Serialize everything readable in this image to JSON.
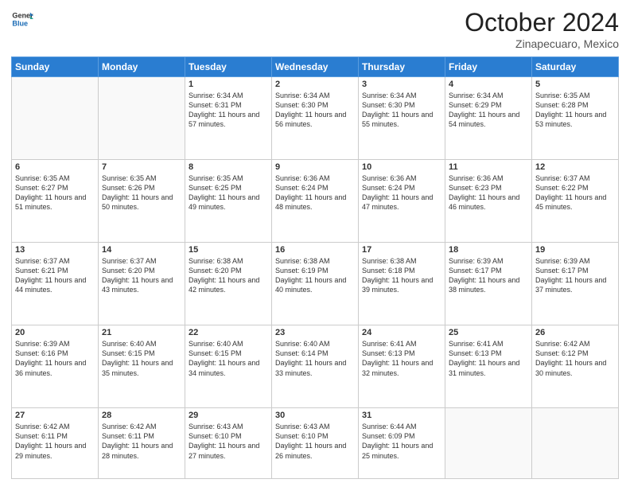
{
  "header": {
    "logo": {
      "line1": "General",
      "line2": "Blue"
    },
    "title": "October 2024",
    "location": "Zinapecuaro, Mexico"
  },
  "weekdays": [
    "Sunday",
    "Monday",
    "Tuesday",
    "Wednesday",
    "Thursday",
    "Friday",
    "Saturday"
  ],
  "weeks": [
    [
      {
        "day": "",
        "empty": true
      },
      {
        "day": "",
        "empty": true
      },
      {
        "day": "1",
        "sunrise": "6:34 AM",
        "sunset": "6:31 PM",
        "daylight": "11 hours and 57 minutes."
      },
      {
        "day": "2",
        "sunrise": "6:34 AM",
        "sunset": "6:30 PM",
        "daylight": "11 hours and 56 minutes."
      },
      {
        "day": "3",
        "sunrise": "6:34 AM",
        "sunset": "6:30 PM",
        "daylight": "11 hours and 55 minutes."
      },
      {
        "day": "4",
        "sunrise": "6:34 AM",
        "sunset": "6:29 PM",
        "daylight": "11 hours and 54 minutes."
      },
      {
        "day": "5",
        "sunrise": "6:35 AM",
        "sunset": "6:28 PM",
        "daylight": "11 hours and 53 minutes."
      }
    ],
    [
      {
        "day": "6",
        "sunrise": "6:35 AM",
        "sunset": "6:27 PM",
        "daylight": "11 hours and 51 minutes."
      },
      {
        "day": "7",
        "sunrise": "6:35 AM",
        "sunset": "6:26 PM",
        "daylight": "11 hours and 50 minutes."
      },
      {
        "day": "8",
        "sunrise": "6:35 AM",
        "sunset": "6:25 PM",
        "daylight": "11 hours and 49 minutes."
      },
      {
        "day": "9",
        "sunrise": "6:36 AM",
        "sunset": "6:24 PM",
        "daylight": "11 hours and 48 minutes."
      },
      {
        "day": "10",
        "sunrise": "6:36 AM",
        "sunset": "6:24 PM",
        "daylight": "11 hours and 47 minutes."
      },
      {
        "day": "11",
        "sunrise": "6:36 AM",
        "sunset": "6:23 PM",
        "daylight": "11 hours and 46 minutes."
      },
      {
        "day": "12",
        "sunrise": "6:37 AM",
        "sunset": "6:22 PM",
        "daylight": "11 hours and 45 minutes."
      }
    ],
    [
      {
        "day": "13",
        "sunrise": "6:37 AM",
        "sunset": "6:21 PM",
        "daylight": "11 hours and 44 minutes."
      },
      {
        "day": "14",
        "sunrise": "6:37 AM",
        "sunset": "6:20 PM",
        "daylight": "11 hours and 43 minutes."
      },
      {
        "day": "15",
        "sunrise": "6:38 AM",
        "sunset": "6:20 PM",
        "daylight": "11 hours and 42 minutes."
      },
      {
        "day": "16",
        "sunrise": "6:38 AM",
        "sunset": "6:19 PM",
        "daylight": "11 hours and 40 minutes."
      },
      {
        "day": "17",
        "sunrise": "6:38 AM",
        "sunset": "6:18 PM",
        "daylight": "11 hours and 39 minutes."
      },
      {
        "day": "18",
        "sunrise": "6:39 AM",
        "sunset": "6:17 PM",
        "daylight": "11 hours and 38 minutes."
      },
      {
        "day": "19",
        "sunrise": "6:39 AM",
        "sunset": "6:17 PM",
        "daylight": "11 hours and 37 minutes."
      }
    ],
    [
      {
        "day": "20",
        "sunrise": "6:39 AM",
        "sunset": "6:16 PM",
        "daylight": "11 hours and 36 minutes."
      },
      {
        "day": "21",
        "sunrise": "6:40 AM",
        "sunset": "6:15 PM",
        "daylight": "11 hours and 35 minutes."
      },
      {
        "day": "22",
        "sunrise": "6:40 AM",
        "sunset": "6:15 PM",
        "daylight": "11 hours and 34 minutes."
      },
      {
        "day": "23",
        "sunrise": "6:40 AM",
        "sunset": "6:14 PM",
        "daylight": "11 hours and 33 minutes."
      },
      {
        "day": "24",
        "sunrise": "6:41 AM",
        "sunset": "6:13 PM",
        "daylight": "11 hours and 32 minutes."
      },
      {
        "day": "25",
        "sunrise": "6:41 AM",
        "sunset": "6:13 PM",
        "daylight": "11 hours and 31 minutes."
      },
      {
        "day": "26",
        "sunrise": "6:42 AM",
        "sunset": "6:12 PM",
        "daylight": "11 hours and 30 minutes."
      }
    ],
    [
      {
        "day": "27",
        "sunrise": "6:42 AM",
        "sunset": "6:11 PM",
        "daylight": "11 hours and 29 minutes."
      },
      {
        "day": "28",
        "sunrise": "6:42 AM",
        "sunset": "6:11 PM",
        "daylight": "11 hours and 28 minutes."
      },
      {
        "day": "29",
        "sunrise": "6:43 AM",
        "sunset": "6:10 PM",
        "daylight": "11 hours and 27 minutes."
      },
      {
        "day": "30",
        "sunrise": "6:43 AM",
        "sunset": "6:10 PM",
        "daylight": "11 hours and 26 minutes."
      },
      {
        "day": "31",
        "sunrise": "6:44 AM",
        "sunset": "6:09 PM",
        "daylight": "11 hours and 25 minutes."
      },
      {
        "day": "",
        "empty": true
      },
      {
        "day": "",
        "empty": true
      }
    ]
  ],
  "labels": {
    "sunrise": "Sunrise:",
    "sunset": "Sunset:",
    "daylight": "Daylight:"
  }
}
